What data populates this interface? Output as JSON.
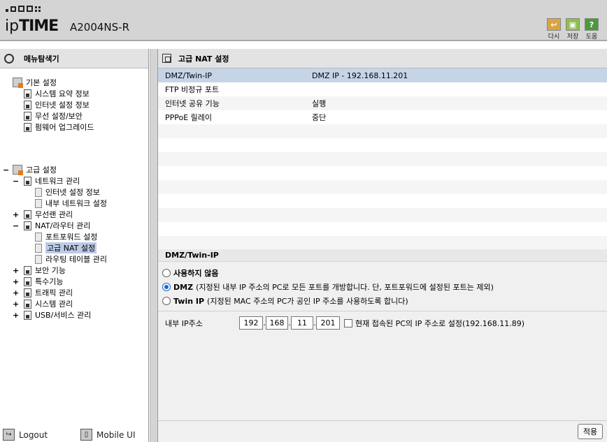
{
  "header": {
    "brand_light": "ip",
    "brand_bold": "TIME",
    "model": "A2004NS-R",
    "buttons": [
      {
        "label": "다시",
        "icon": "retry-icon",
        "color": "#d9a441"
      },
      {
        "label": "저장",
        "icon": "save-icon",
        "color": "#8fbf4f"
      },
      {
        "label": "도움",
        "icon": "help-icon",
        "color": "#4a9a3c"
      }
    ]
  },
  "sidebar": {
    "title": "메뉴탐색기",
    "basic": {
      "label": "기본 설정",
      "items": [
        "시스템 요약 정보",
        "인터넷 설정 정보",
        "무선 설정/보안",
        "펌웨어 업그레이드"
      ]
    },
    "advanced": {
      "label": "고급 설정",
      "groups": [
        {
          "label": "네트워크 관리",
          "toggle": "−",
          "children": [
            "인터넷 설정 정보",
            "내부 네트워크 설정"
          ]
        },
        {
          "label": "무선랜 관리",
          "toggle": "+",
          "children": []
        },
        {
          "label": "NAT/라우터 관리",
          "toggle": "−",
          "children": [
            "포트포워드 설정",
            "고급 NAT 설정",
            "라우팅 테이블 관리"
          ]
        },
        {
          "label": "보안 기능",
          "toggle": "+",
          "children": []
        },
        {
          "label": "특수기능",
          "toggle": "+",
          "children": []
        },
        {
          "label": "트래픽 관리",
          "toggle": "+",
          "children": []
        },
        {
          "label": "시스템 관리",
          "toggle": "+",
          "children": []
        },
        {
          "label": "USB/서비스 관리",
          "toggle": "+",
          "children": []
        }
      ]
    },
    "bottom": {
      "logout": "Logout",
      "mobile": "Mobile UI"
    }
  },
  "main": {
    "title": "고급 NAT 설정",
    "rows": [
      {
        "name": "DMZ/Twin-IP",
        "value": "DMZ IP - 192.168.11.201"
      },
      {
        "name": "FTP 비정규 포트",
        "value": ""
      },
      {
        "name": "인터넷 공유 기능",
        "value": "실행"
      },
      {
        "name": "PPPoE 릴레이",
        "value": "중단"
      }
    ],
    "section": {
      "title": "DMZ/Twin-IP",
      "options": [
        {
          "bold": "사용하지 않음",
          "desc": "",
          "selected": false
        },
        {
          "bold": "DMZ",
          "desc": "(지정된 내부 IP 주소의 PC로 모든 포트를 개방합니다. 단, 포트포워드에 설정된 포트는 제외)",
          "selected": true
        },
        {
          "bold": "Twin IP",
          "desc": "(지정된 MAC 주소의 PC가 공인 IP 주소를 사용하도록 합니다)",
          "selected": false
        }
      ],
      "ip_label": "내부 IP주소",
      "ip": [
        "192",
        "168",
        "11",
        "201"
      ],
      "checkbox_label": "현재 접속된 PC의 IP 주소로 설정(192.168.11.89)",
      "apply": "적용"
    }
  }
}
